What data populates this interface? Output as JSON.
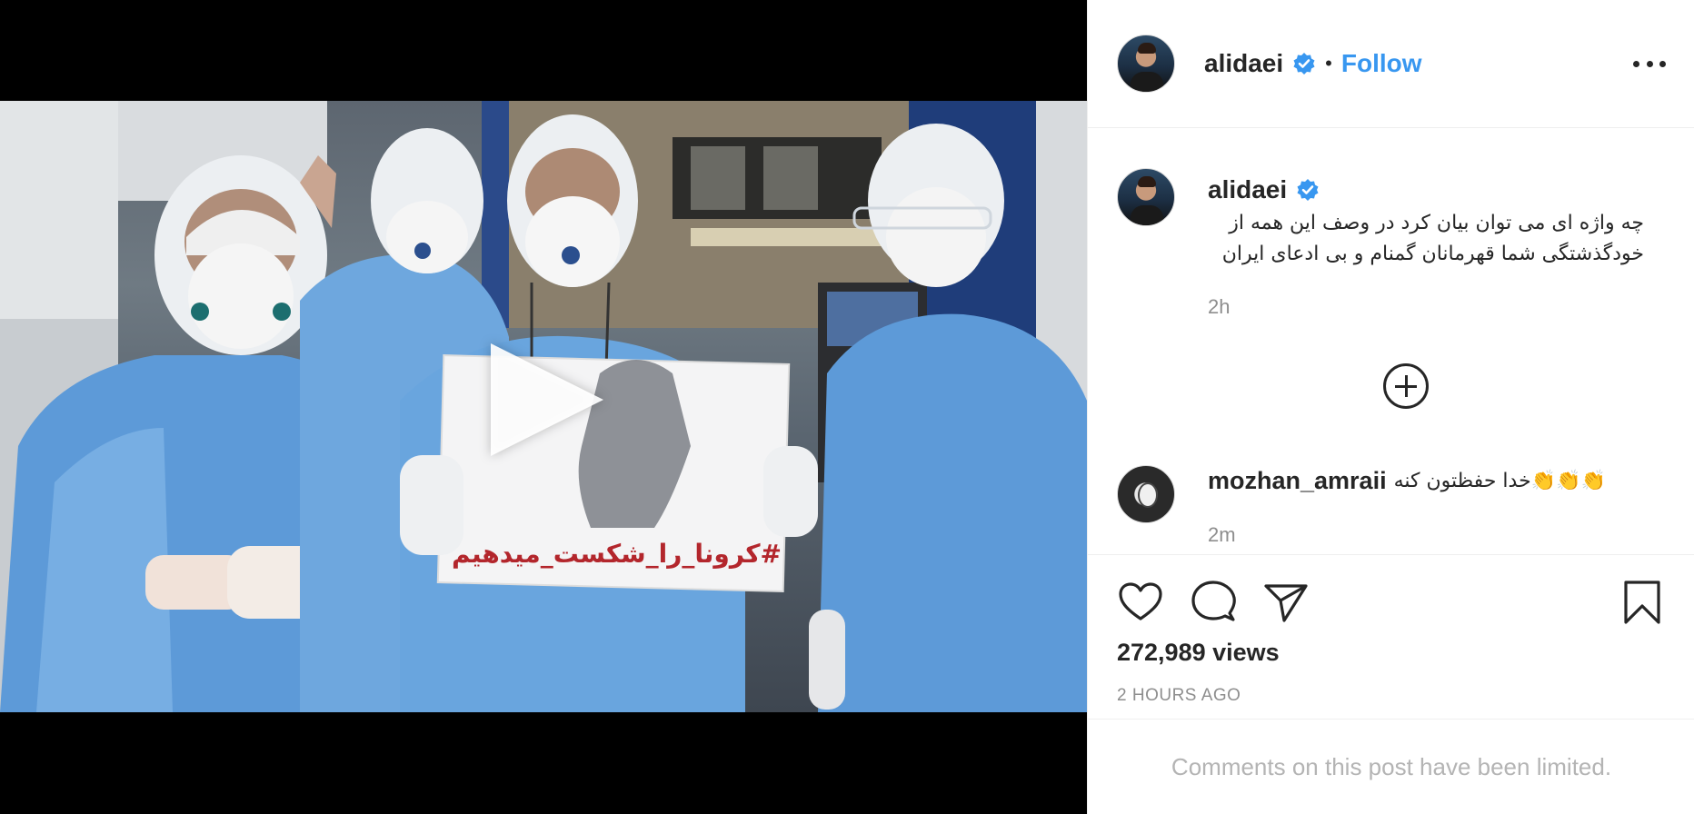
{
  "post": {
    "author": "alidaei",
    "follow_label": "Follow",
    "separator": "•",
    "caption_line1": "چه واژه ای می توان بیان کرد در وصف این همه از",
    "caption_line2": "خودگذشتگی شما قهرمانان گمنام و بی ادعای ایران",
    "caption_time": "2h",
    "views": "272,989 views",
    "posted_ago": "2 HOURS AGO",
    "comments_limited": "Comments on this post have been limited."
  },
  "media": {
    "sign_text": "#کرونا_را_شکست_میدهیم"
  },
  "comments": [
    {
      "user": "mozhan_amraii",
      "text": "👏👏👏خدا حفظتون کنه",
      "time": "2m"
    }
  ],
  "icons": {
    "verified": "verified-badge-icon",
    "more": "more-options-icon",
    "play": "play-icon",
    "load_more": "plus-circle-icon",
    "like": "heart-icon",
    "comment": "comment-bubble-icon",
    "share": "paper-plane-icon",
    "save": "bookmark-icon"
  },
  "colors": {
    "accent": "#3897f0",
    "text": "#262626",
    "muted": "#8e8e8e",
    "verified": "#3897f0"
  }
}
